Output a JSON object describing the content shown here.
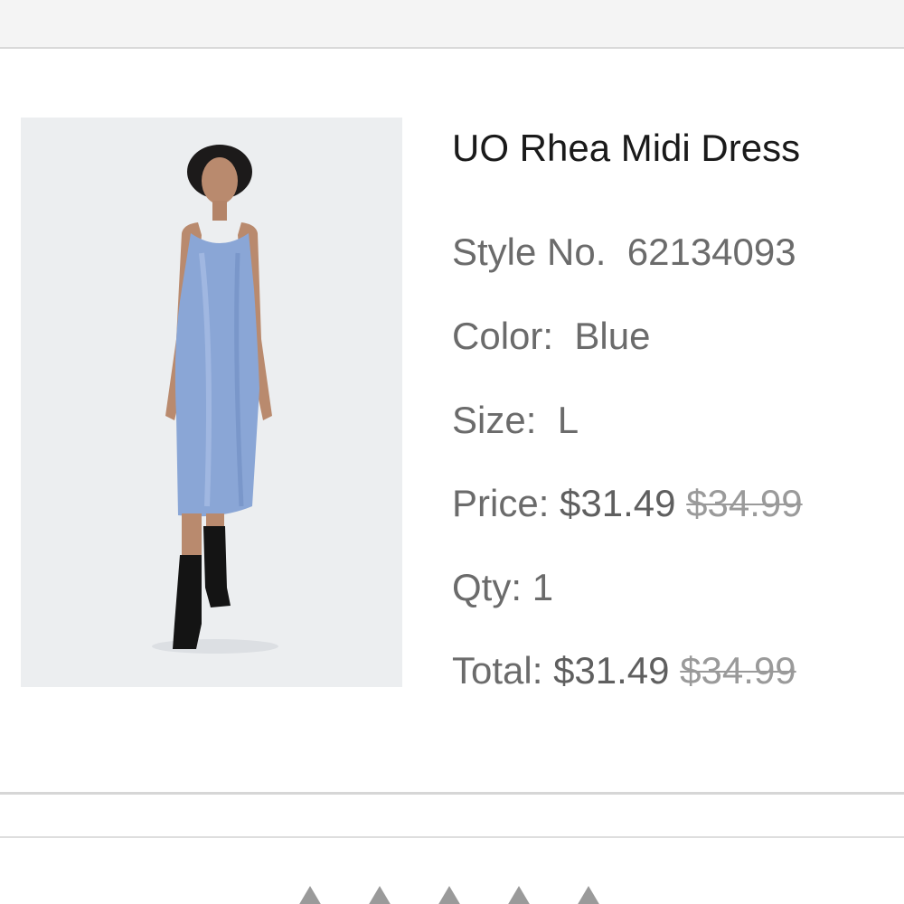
{
  "product": {
    "name": "UO Rhea Midi Dress",
    "image_icon": "dress-photo",
    "style_label": "Style No.",
    "style_number": "62134093",
    "color_label": "Color:",
    "color": "Blue",
    "size_label": "Size:",
    "size": "L",
    "price_label": "Price:",
    "price": "$31.49",
    "price_original": "$34.99",
    "qty_label": "Qty:",
    "qty": "1",
    "total_label": "Total:",
    "total": "$31.49",
    "total_original": "$34.99"
  },
  "rating": {
    "icon": "star-icon",
    "stars_visible": 5
  },
  "colors": {
    "dress": "#8aa6d6",
    "image_bg": "#eceef0",
    "text_primary": "#1a1a1a",
    "text_secondary": "#6b6b6b"
  }
}
